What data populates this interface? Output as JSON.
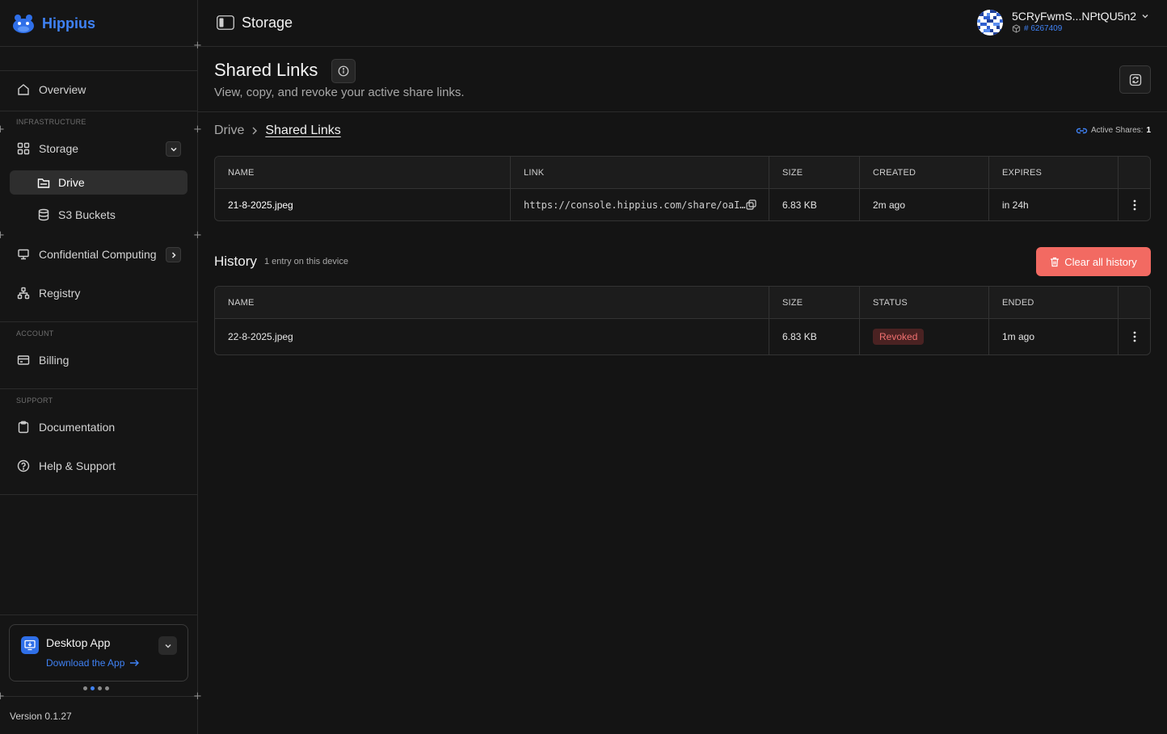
{
  "brand": {
    "name": "Hippius"
  },
  "sidebar": {
    "sections": {
      "infrastructure": "INFRASTRUCTURE",
      "account": "ACCOUNT",
      "support": "SUPPORT"
    },
    "items": {
      "overview": "Overview",
      "storage": "Storage",
      "drive": "Drive",
      "s3": "S3 Buckets",
      "confidential": "Confidential Computing",
      "registry": "Registry",
      "billing": "Billing",
      "docs": "Documentation",
      "help": "Help & Support"
    },
    "desktop": {
      "title": "Desktop App",
      "link": "Download the App"
    },
    "version": "Version 0.1.27"
  },
  "topbar": {
    "title": "Storage",
    "account_name": "5CRyFwmS...NPtQU5n2",
    "account_id": "# 6267409"
  },
  "header": {
    "title": "Shared Links",
    "subtitle": "View, copy, and revoke your active share links."
  },
  "breadcrumb": {
    "root": "Drive",
    "current": "Shared Links"
  },
  "active_shares": {
    "label": "Active Shares:",
    "count": "1"
  },
  "shares_table": {
    "columns": {
      "name": "NAME",
      "link": "LINK",
      "size": "SIZE",
      "created": "CREATED",
      "expires": "EXPIRES"
    },
    "rows": [
      {
        "name": "21-8-2025.jpeg",
        "link": "https://console.hippius.com/share/oaI…",
        "size": "6.83 KB",
        "created": "2m ago",
        "expires": "in 24h"
      }
    ]
  },
  "history": {
    "title": "History",
    "subtitle": "1 entry on this device",
    "clear_label": "Clear all history",
    "columns": {
      "name": "NAME",
      "size": "SIZE",
      "status": "STATUS",
      "ended": "ENDED"
    },
    "rows": [
      {
        "name": "22-8-2025.jpeg",
        "size": "6.83 KB",
        "status": "Revoked",
        "ended": "1m ago"
      }
    ]
  },
  "colors": {
    "accent": "#3f82f5",
    "danger": "#f26a62",
    "background": "#141414"
  }
}
